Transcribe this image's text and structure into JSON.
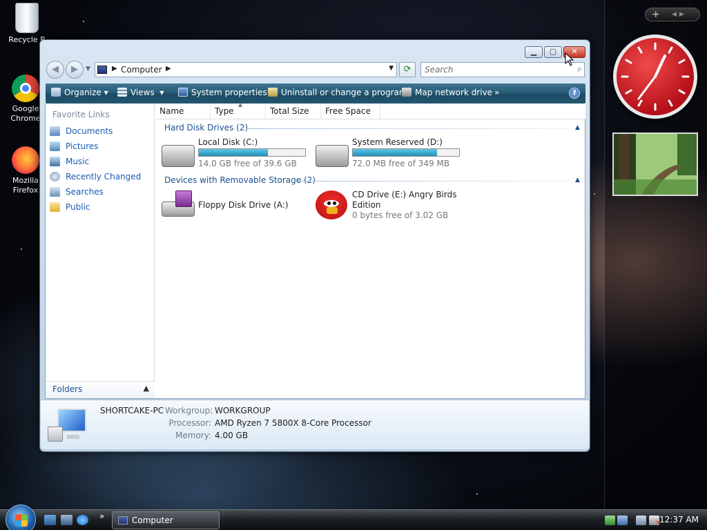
{
  "desktop": {
    "icons": [
      {
        "label_1": "Recycle B",
        "label_2": ""
      },
      {
        "label_1": "Google",
        "label_2": "Chrome"
      },
      {
        "label_1": "Mozilla",
        "label_2": "Firefox"
      }
    ]
  },
  "window": {
    "address": {
      "location": "Computer"
    },
    "search": {
      "placeholder": "Search"
    },
    "toolbar": {
      "organize": "Organize",
      "views": "Views",
      "system_properties": "System properties",
      "uninstall": "Uninstall or change a program",
      "map_drive": "Map network drive",
      "more": "»",
      "help": "?"
    },
    "nav_pane": {
      "title": "Favorite Links",
      "items": [
        "Documents",
        "Pictures",
        "Music",
        "Recently Changed",
        "Searches",
        "Public"
      ],
      "folders_label": "Folders"
    },
    "columns": [
      "Name",
      "Type",
      "Total Size",
      "Free Space"
    ],
    "groups": {
      "hdd": {
        "title": "Hard Disk Drives (2)",
        "drives": [
          {
            "name": "Local Disk (C:)",
            "free": "14.0 GB free of 39.6 GB",
            "used_fraction": 0.65
          },
          {
            "name": "System Reserved (D:)",
            "free": "72.0 MB free of 349 MB",
            "used_fraction": 0.79
          }
        ]
      },
      "removable": {
        "title": "Devices with Removable Storage (2)",
        "floppy": {
          "name": "Floppy Disk Drive (A:)"
        },
        "cd": {
          "name_1": "CD Drive (E:) Angry Birds",
          "name_2": "Edition",
          "free": "0 bytes free of 3.02 GB"
        }
      }
    },
    "details": {
      "pc_name": "SHORTCAKE-PC",
      "workgroup_label": "Workgroup:",
      "workgroup": "WORKGROUP",
      "processor_label": "Processor:",
      "processor": "AMD Ryzen 7 5800X 8-Core Processor",
      "memory_label": "Memory:",
      "memory": "4.00 GB"
    }
  },
  "taskbar": {
    "task_label": "Computer",
    "time": "12:37 AM",
    "ql_more": "»"
  },
  "sidebar": {
    "add_label": "+"
  },
  "colors": {
    "accent": "#1a5bb5",
    "toolbar": "#245a75",
    "bar_fill": "#1f8fb8",
    "close_button": "#c5321f"
  }
}
